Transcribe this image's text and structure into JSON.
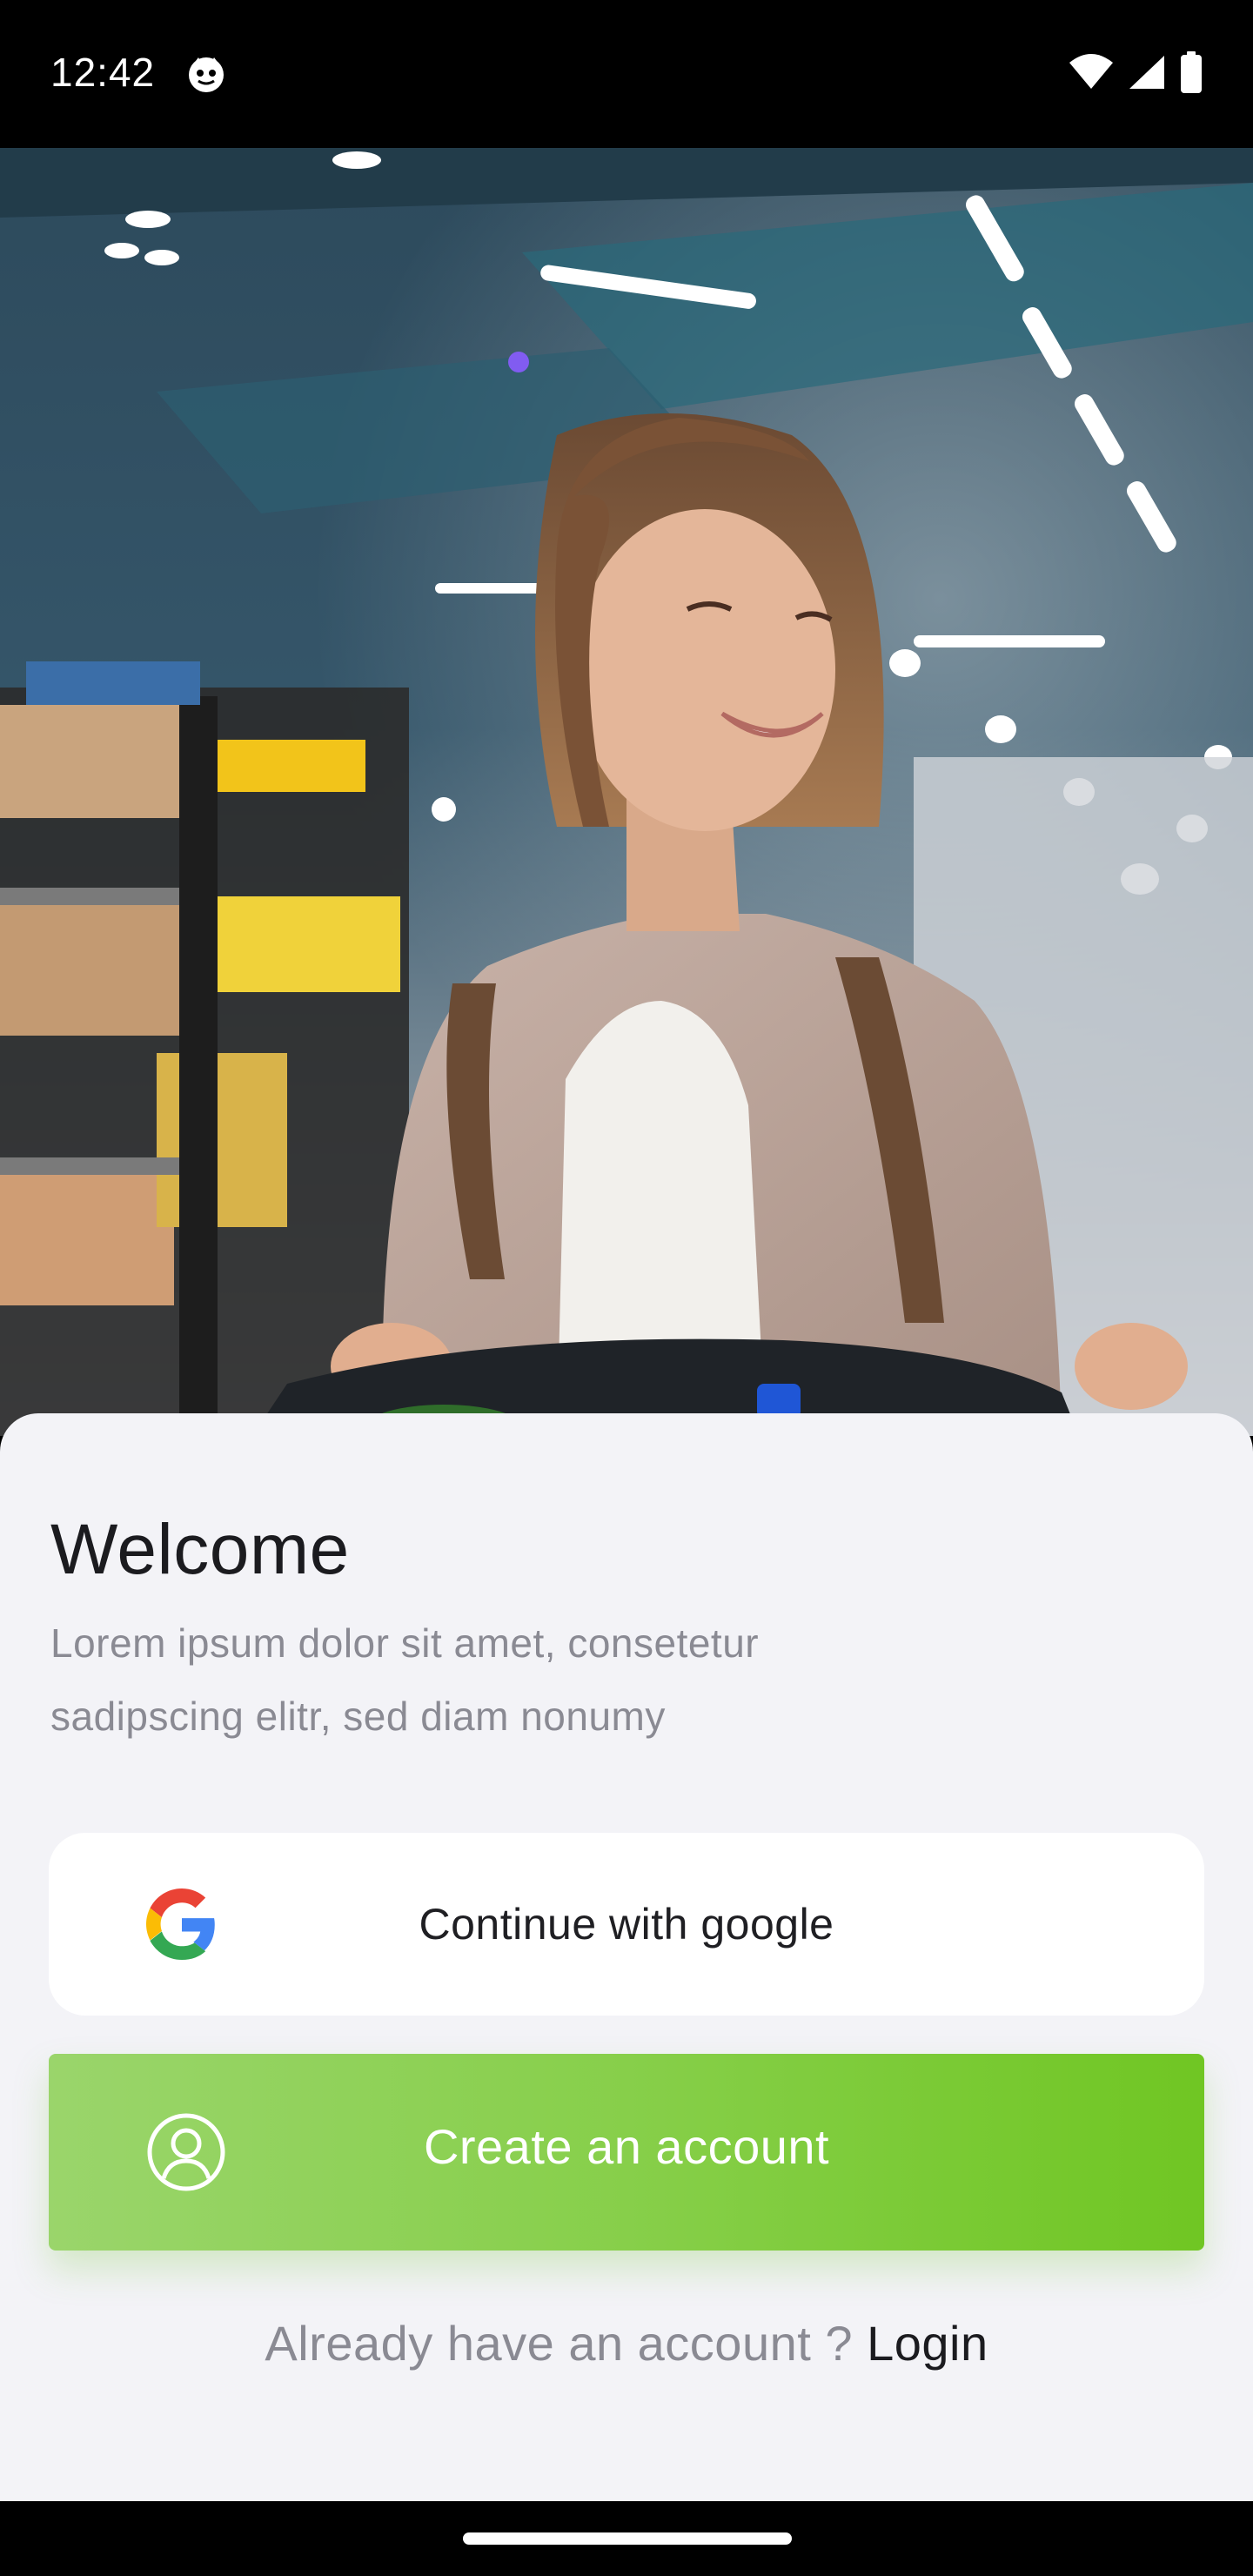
{
  "status_bar": {
    "time": "12:42",
    "icons": [
      "cat-notification-icon",
      "wifi-icon",
      "cellular-signal-icon",
      "battery-icon"
    ]
  },
  "hero": {
    "image": "woman-shopping-cart-supermarket-photo"
  },
  "welcome": {
    "title": "Welcome",
    "subtitle_line1": "Lorem ipsum dolor sit amet, consetetur",
    "subtitle_line2": "sadipscing elitr, sed diam nonumy"
  },
  "buttons": {
    "google_label": "Continue with google",
    "google_icon": "google-g-icon",
    "create_label": "Create an account",
    "create_icon": "user-circle-icon"
  },
  "login": {
    "prompt": "Already have an account ?",
    "link": "Login"
  },
  "colors": {
    "sheet_bg": "#f3f3f7",
    "accent_start": "#9ad56b",
    "accent_end": "#70c623",
    "title": "#1b1b1f",
    "muted": "#8a8a93"
  }
}
